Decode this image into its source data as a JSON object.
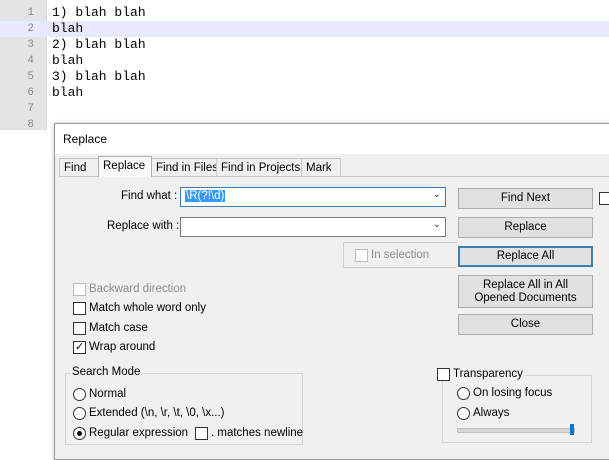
{
  "editor": {
    "lines": [
      {
        "num": "1",
        "text": "1) blah blah"
      },
      {
        "num": "2",
        "text": "blah"
      },
      {
        "num": "3",
        "text": "2) blah blah"
      },
      {
        "num": "4",
        "text": "blah"
      },
      {
        "num": "5",
        "text": "3) blah blah"
      },
      {
        "num": "6",
        "text": "blah"
      },
      {
        "num": "7",
        "text": ""
      },
      {
        "num": "8",
        "text": ""
      }
    ]
  },
  "dialog": {
    "title": "Replace",
    "tabs": [
      {
        "label": "Find"
      },
      {
        "label": "Replace"
      },
      {
        "label": "Find in Files"
      },
      {
        "label": "Find in Projects"
      },
      {
        "label": "Mark"
      }
    ],
    "find_what": {
      "label": "Find what :",
      "value": "\\R(?!\\d)"
    },
    "replace_with": {
      "label": "Replace with :",
      "value": ""
    },
    "in_selection": "In selection",
    "options": {
      "backward": "Backward direction",
      "whole_word": "Match whole word only",
      "match_case": "Match case",
      "wrap_around": "Wrap around"
    },
    "search_mode": {
      "title": "Search Mode",
      "normal": "Normal",
      "extended": "Extended (\\n, \\r, \\t, \\0, \\x...)",
      "regex": "Regular expression",
      "matches_newline": ". matches newline"
    },
    "transparency": {
      "title": "Transparency",
      "on_losing_focus": "On losing focus",
      "always": "Always",
      "level": 1.0
    },
    "buttons": {
      "find_next": "Find Next",
      "replace": "Replace",
      "replace_all": "Replace All",
      "replace_all_opened": "Replace All in All Opened Documents",
      "close": "Close"
    }
  }
}
